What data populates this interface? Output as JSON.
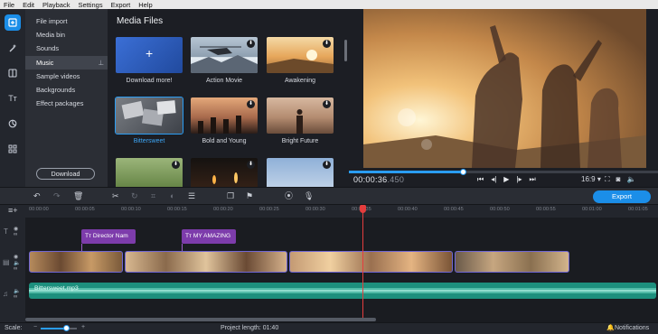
{
  "menu": [
    "File",
    "Edit",
    "Playback",
    "Settings",
    "Export",
    "Help"
  ],
  "categories": [
    {
      "label": "File import"
    },
    {
      "label": "Media bin"
    },
    {
      "label": "Sounds"
    },
    {
      "label": "Music",
      "selected": true
    },
    {
      "label": "Sample videos"
    },
    {
      "label": "Backgrounds"
    },
    {
      "label": "Effect packages"
    }
  ],
  "download_label": "Download",
  "media": {
    "title": "Media Files",
    "tiles": [
      {
        "label": "Download more!",
        "kind": "add"
      },
      {
        "label": "Action Movie",
        "kind": "download"
      },
      {
        "label": "Awakening",
        "kind": "download"
      },
      {
        "label": "Bittersweet",
        "kind": "selected"
      },
      {
        "label": "Bold and Young",
        "kind": "download"
      },
      {
        "label": "Bright Future",
        "kind": "download"
      }
    ]
  },
  "preview": {
    "timecode_main": "00:00:36",
    "timecode_ms": ".450",
    "aspect": "16:9",
    "progress_fraction": 0.37
  },
  "export_label": "Export",
  "ruler": [
    "00:00:00",
    "00:00:05",
    "00:00:10",
    "00:00:15",
    "00:00:20",
    "00:00:25",
    "00:00:30",
    "00:00:35",
    "00:00:40",
    "00:00:45",
    "00:00:50",
    "00:00:55",
    "00:01:00",
    "00:01:05"
  ],
  "title_clips": [
    "Director Nam",
    "MY AMAZING"
  ],
  "audio_clip": "Bittersweet.mp3",
  "status": {
    "scale_label": "Scale:",
    "project_length": "Project length:  01:40",
    "notifications": "Notifications"
  },
  "colors": {
    "accent": "#1b8ee8",
    "title_clip": "#7d3cab",
    "audio_clip": "#1d8f7d",
    "playhead": "#e53d3d"
  }
}
